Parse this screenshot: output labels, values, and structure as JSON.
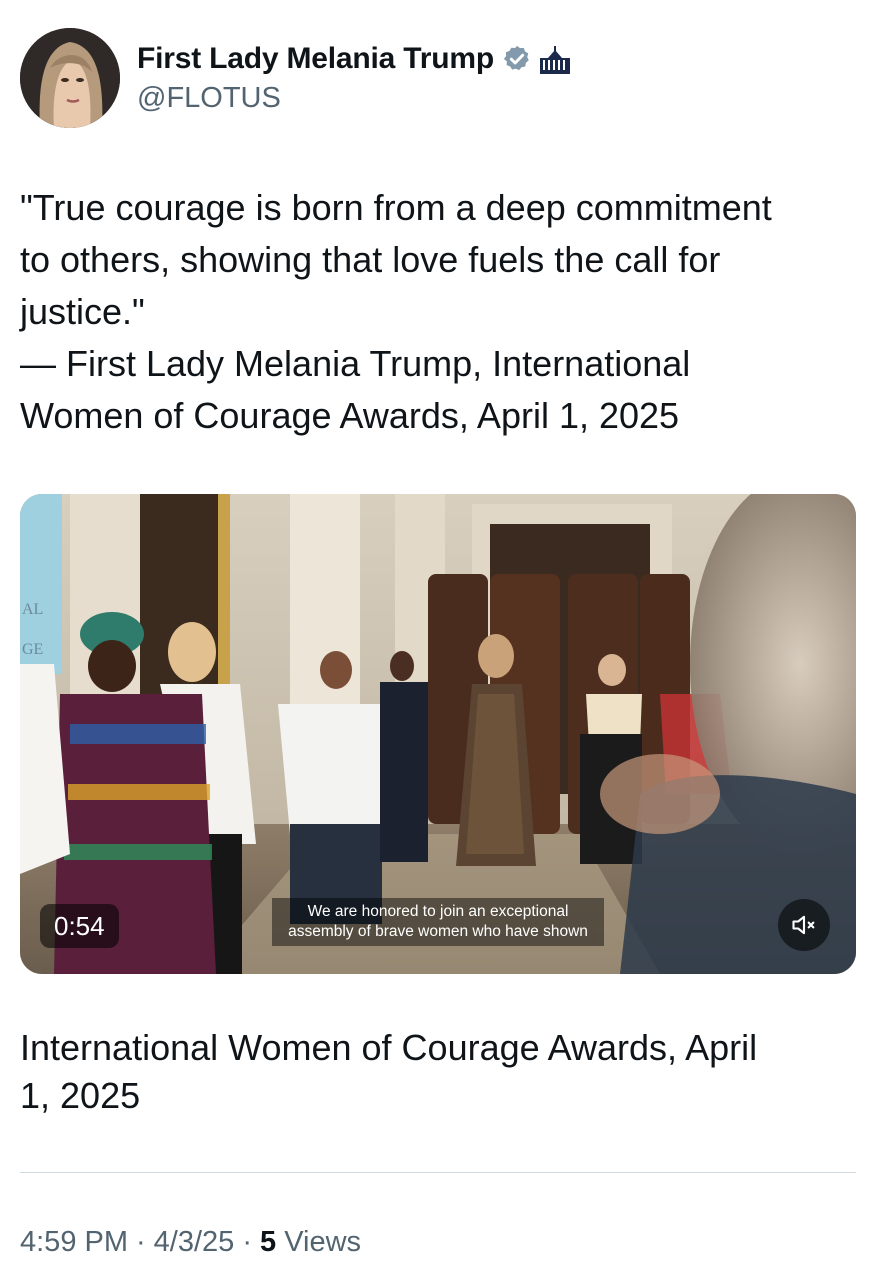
{
  "header": {
    "display_name": "First Lady Melania Trump",
    "handle": "@FLOTUS",
    "verified": true,
    "badge_color": "#829aab"
  },
  "tweet": {
    "text": "\"True courage is born from a deep commitment\nto others, showing that love fuels the call for\njustice.\"\n— First Lady Melania Trump, International\nWomen of Courage Awards, April 1, 2025"
  },
  "video": {
    "duration": "0:54",
    "caption": "We are honored to join an exceptional\nassembly of brave women who have shown",
    "muted": true,
    "sign_text_1": "AL",
    "sign_text_2": "GE"
  },
  "media_title": "International Women of Courage Awards, April\n1, 2025",
  "meta": {
    "time": "4:59 PM",
    "separator": "·",
    "date": "4/3/25",
    "views_count": "5",
    "views_label": "Views"
  },
  "icons": {
    "verified": "verified-badge-icon",
    "affiliation": "white-house-icon",
    "mute": "speaker-muted-icon"
  }
}
